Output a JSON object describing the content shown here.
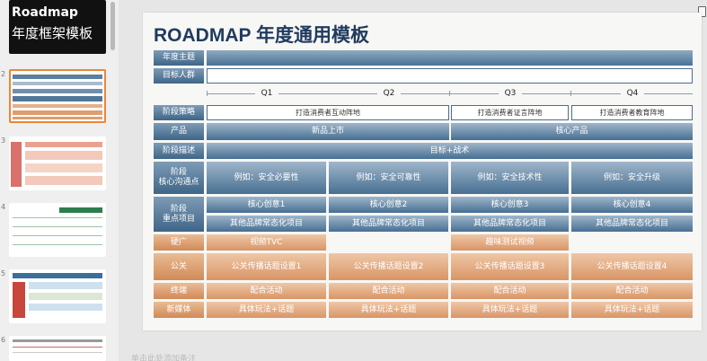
{
  "thumbnails": {
    "numbers": [
      "2",
      "3",
      "4",
      "5",
      "6"
    ],
    "slide1": {
      "line1": "Roadmap",
      "line2": "年度框架模板"
    }
  },
  "slide": {
    "title": "ROADMAP 年度通用模板",
    "row_labels": {
      "theme": "年度主题",
      "audience": "目标人群",
      "strategy": "阶段策略",
      "product": "产品",
      "description": "阶段描述",
      "core_message": "阶段\n核心沟通点",
      "key_projects": "阶段\n重点项目",
      "ads": "硬广",
      "pr": "公关",
      "trade": "终端",
      "new_media": "新媒体"
    },
    "quarters": [
      "Q1",
      "Q2",
      "Q3",
      "Q4"
    ],
    "strategy_cells": [
      "打造消费者互动阵地",
      "打造消费者证言阵地",
      "打造消费者教育阵地"
    ],
    "product_cells": [
      "新品上市",
      "核心产品"
    ],
    "description": "目标+战术",
    "core_messages": [
      "例如：安全必要性",
      "例如：安全可靠性",
      "例如：安全技术性",
      "例如：安全升级"
    ],
    "key_creatives": [
      "核心创意1",
      "核心创意2",
      "核心创意3",
      "核心创意4"
    ],
    "other_projects": [
      "其他品牌常态化项目",
      "其他品牌常态化项目",
      "其他品牌常态化项目",
      "其他品牌常态化项目"
    ],
    "ads_cells": [
      "视频TVC",
      "趣味测试视频"
    ],
    "pr_cells": [
      "公关传播话题设置1",
      "公关传播话题设置2",
      "公关传播话题设置3",
      "公关传播话题设置4"
    ],
    "trade_cells": [
      "配合活动",
      "配合活动",
      "配合活动",
      "配合活动"
    ],
    "new_media_cells": [
      "具体玩法+话题",
      "具体玩法+话题",
      "具体玩法+话题",
      "具体玩法+话题"
    ]
  },
  "notes_placeholder": "单击此处添加备注",
  "colors": {
    "title": "#1f3b5e",
    "accent_orange": "#d99566",
    "accent_blue": "#3e6587",
    "thumb_selected": "#e8873a"
  }
}
